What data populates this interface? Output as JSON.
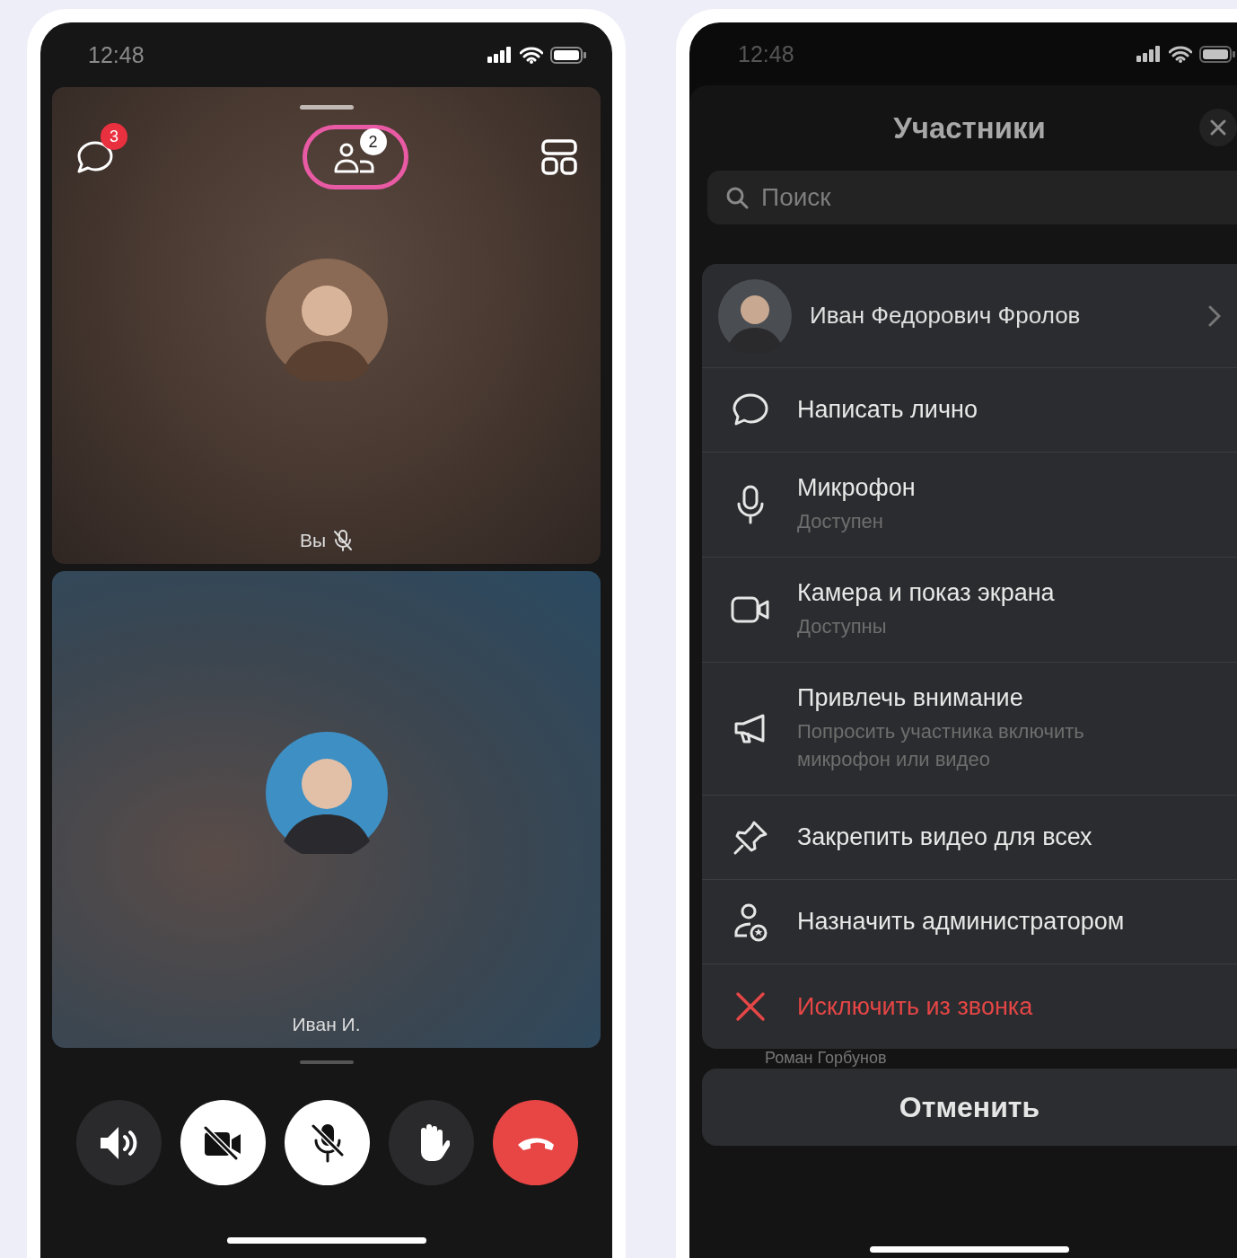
{
  "call_screen": {
    "status_bar": {
      "time": "12:48"
    },
    "toolbar": {
      "chat_badge": "3",
      "participants_badge": "2",
      "participants_highlighted": true
    },
    "tiles": [
      {
        "label": "Вы",
        "muted": true,
        "kind": "warm"
      },
      {
        "label": "Иван И.",
        "muted": false,
        "kind": "cool"
      }
    ],
    "controls": [
      {
        "kind": "speaker",
        "active": false
      },
      {
        "kind": "camera",
        "active": true
      },
      {
        "kind": "microphone",
        "active": true
      },
      {
        "kind": "hand",
        "active": false
      },
      {
        "kind": "hangup",
        "active": false
      }
    ]
  },
  "participants_sheet": {
    "status_bar": {
      "time": "12:48"
    },
    "title": "Участники",
    "search": {
      "placeholder": "Поиск"
    },
    "person": {
      "name": "Иван Федорович Фролов"
    },
    "actions": [
      {
        "kind": "message",
        "label": "Написать лично",
        "danger": false
      },
      {
        "kind": "microphone",
        "label": "Микрофон",
        "sublabel": "Доступен",
        "danger": false
      },
      {
        "kind": "camera",
        "label": "Камера и показ экрана",
        "sublabel": "Доступны",
        "danger": false
      },
      {
        "kind": "attention",
        "label": "Привлечь внимание",
        "sublabel": "Попросить участника включить микрофон или видео",
        "danger": false
      },
      {
        "kind": "pin",
        "label": "Закрепить видео для всех",
        "danger": false
      },
      {
        "kind": "admin",
        "label": "Назначить администратором",
        "danger": false
      },
      {
        "kind": "remove",
        "label": "Исключить из звонка",
        "danger": true
      }
    ],
    "behind_item": {
      "name": "Роман Горбунов"
    },
    "cancel_button": "Отменить"
  }
}
